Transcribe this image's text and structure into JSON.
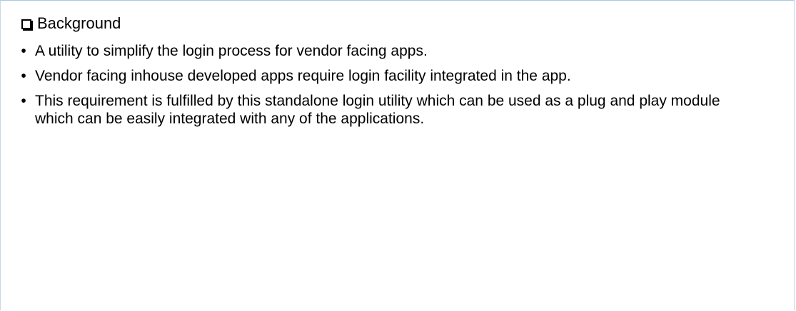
{
  "heading": {
    "icon": "checkbox-icon",
    "label": "Background"
  },
  "bullets": [
    "A utility to simplify the login process for vendor facing apps.",
    "Vendor facing inhouse developed apps require login facility integrated in the app.",
    "This requirement is fulfilled by this standalone login utility which can be used as a plug and play module which can be easily integrated with any of the applications."
  ],
  "bullet_marker": "•"
}
